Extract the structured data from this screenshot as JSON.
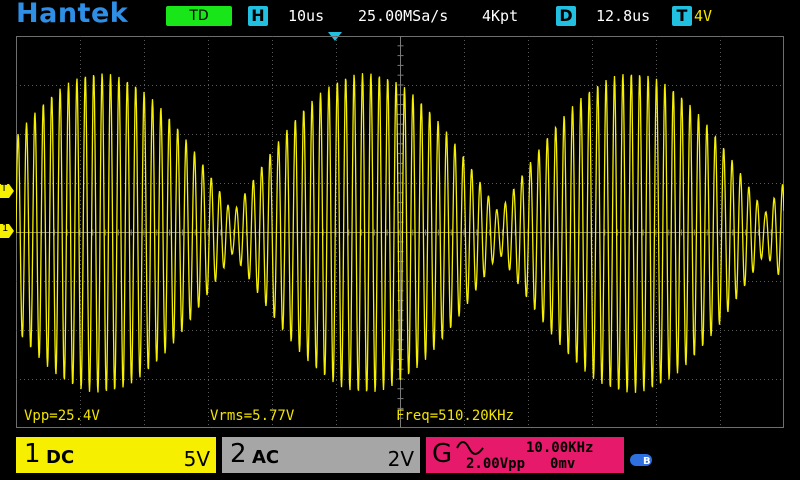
{
  "brand": "Hantek",
  "header": {
    "mode": "TD",
    "h_badge": "H",
    "timebase": "10us",
    "sample_rate": "25.00MSa/s",
    "memory_depth": "4Kpt",
    "d_badge": "D",
    "delay": "12.8us",
    "t_badge": "T",
    "trigger_level": "4V"
  },
  "markers": {
    "trigger": "T",
    "channel1": "1"
  },
  "measurements": {
    "vpp": "Vpp=25.4V",
    "vrms": "Vrms=5.77V",
    "freq": "Freq=510.20KHz"
  },
  "channel1": {
    "number": "1",
    "coupling": "DC",
    "scale": "5V"
  },
  "channel2": {
    "number": "2",
    "coupling": "AC",
    "scale": "2V"
  },
  "generator": {
    "label": "G",
    "waveform_icon": "sine-icon",
    "frequency": "10.00KHz",
    "amplitude": "2.00Vpp",
    "offset": "0mv"
  },
  "usb_icon": "usb-icon",
  "colors": {
    "ch1": "#f6f000",
    "ch2": "#a6a6a6",
    "gen": "#e6196a",
    "accent": "#22c0e0",
    "brand": "#2f8fe6",
    "mode": "#19e619"
  }
}
